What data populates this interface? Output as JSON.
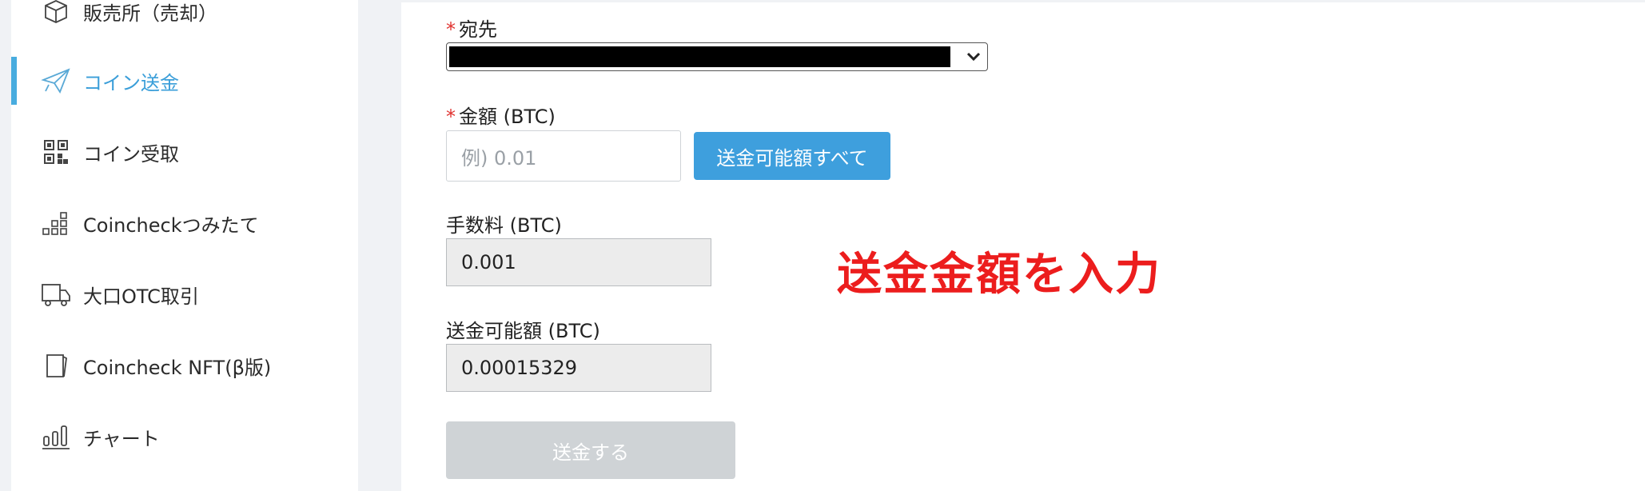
{
  "sidebar": {
    "items": [
      {
        "label": "販売所（売却）",
        "icon": "box-icon"
      },
      {
        "label": "コイン送金",
        "icon": "paper-plane-icon",
        "active": true
      },
      {
        "label": "コイン受取",
        "icon": "qr-code-icon"
      },
      {
        "label": "Coincheckつみたて",
        "icon": "blocks-icon"
      },
      {
        "label": "大口OTC取引",
        "icon": "truck-icon"
      },
      {
        "label": "Coincheck NFT(β版)",
        "icon": "card-icon"
      },
      {
        "label": "チャート",
        "icon": "bar-chart-icon"
      }
    ],
    "accent_color": "#48acdf"
  },
  "form": {
    "destination": {
      "required_mark": "*",
      "label": "宛先"
    },
    "amount": {
      "required_mark": "*",
      "label": "金額 (BTC)",
      "placeholder": "例) 0.01",
      "all_button": "送金可能額すべて"
    },
    "fee": {
      "label": "手数料 (BTC)",
      "value": "0.001"
    },
    "available": {
      "label": "送金可能額 (BTC)",
      "value": "0.00015329"
    },
    "submit_label": "送金する"
  },
  "annotation": {
    "text": "送金金額を入力",
    "color": "#ec1d1d"
  }
}
